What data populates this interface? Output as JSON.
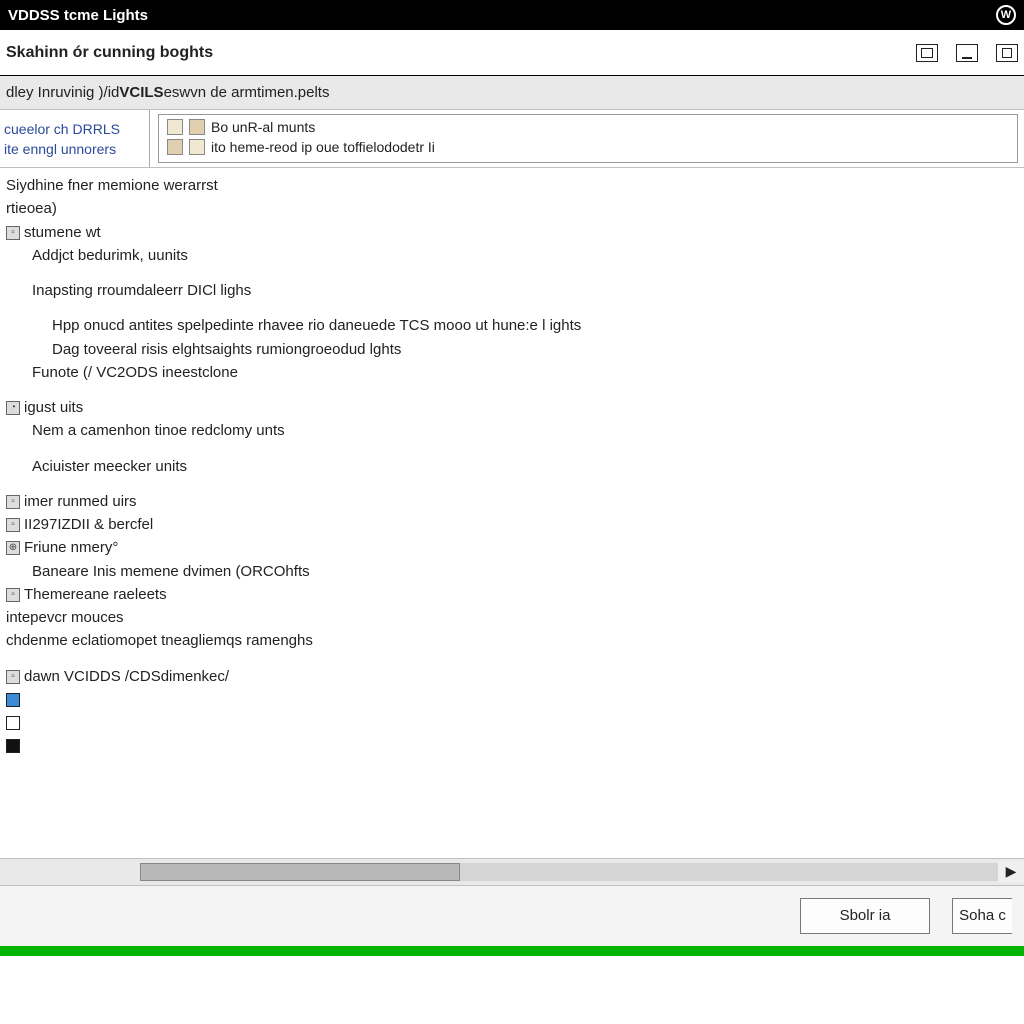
{
  "titlebar": {
    "title": "VDDSS tcme Lights"
  },
  "subheader": {
    "text": "Skahinn ór cunning boghts"
  },
  "crumb": {
    "prefix": "dley Inruvinig )/id ",
    "strong": "VCILS",
    "suffix": " eswvn de armtimen.pelts"
  },
  "leftcol": {
    "row1": "cueelor ch DRRLS",
    "row2": "ite enngl unnorers"
  },
  "toolbox": {
    "line1": "Bo unR-al munts",
    "line2": "ito heme-reod ip oue toffielododetr Ii"
  },
  "tree": {
    "l1": "Siydhine fner memione werarrst",
    "l2": "rtieoea)",
    "l3": "stumene wt",
    "l4": "Addjct bedurimk, uunits",
    "l5": "Inapsting rroumdaleerr DICl lighs",
    "l6": "Hpp onucd antites spelpedinte rhavee rio daneuede TCS mooo ut hune:e l ights",
    "l7": "Dag toveeral risis elghtsaights rumiongroeodud lghts",
    "l8": "Funote (/ VC2ODS ineestclone",
    "l9": "igust uits",
    "l10": "Nem a camenhon tinoe redclomy unts",
    "l11": "Aciuister meecker units",
    "l12": "imer runmed uirs",
    "l13": "II297IZDII & bercfel",
    "l14": "Friune nmery°",
    "l15": "Baneare Inis memene dvimen (ORCOhfts",
    "l16": "Themereane raeleets",
    "l17": "intepevcr mouces",
    "l18": "chdenme eclatiomopet tneagliemqs ramenghs",
    "l19": "dawn VCIDDS  /CDSdimenkec/"
  },
  "buttons": {
    "primary": "Sbolr ia",
    "secondary": "Soha c"
  }
}
